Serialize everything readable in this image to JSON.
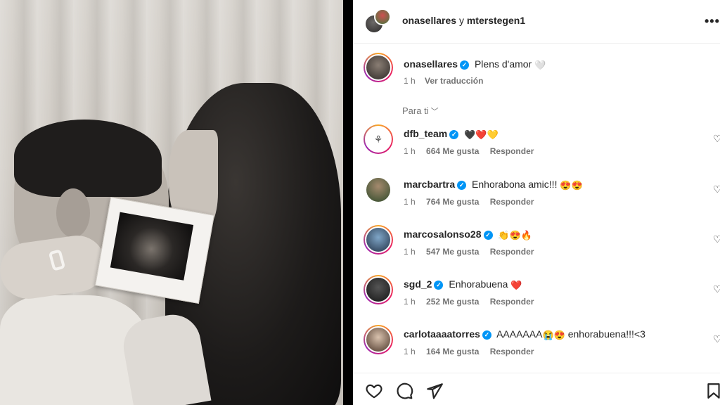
{
  "header": {
    "user1": "onasellares",
    "connector": "y",
    "user2": "mterstegen1",
    "more": "•••"
  },
  "caption": {
    "username": "onasellares",
    "text": "Plens d'amor",
    "emoji": "🤍",
    "time": "1 h",
    "translate": "Ver traducción"
  },
  "filter": {
    "label": "Para ti"
  },
  "comments": [
    {
      "username": "dfb_team",
      "text": "",
      "emojis": "🖤❤️💛",
      "time": "1 h",
      "likes": "664 Me gusta",
      "reply": "Responder"
    },
    {
      "username": "marcbartra",
      "text": "Enhorabona amic!!!",
      "emojis": "😍😍",
      "time": "1 h",
      "likes": "764 Me gusta",
      "reply": "Responder"
    },
    {
      "username": "marcosalonso28",
      "text": "",
      "emojis": "👏😍🔥",
      "time": "1 h",
      "likes": "547 Me gusta",
      "reply": "Responder"
    },
    {
      "username": "sgd_2",
      "text": "Enhorabuena",
      "emojis": "❤️",
      "time": "1 h",
      "likes": "252 Me gusta",
      "reply": "Responder"
    },
    {
      "username": "carlotaaaatorres",
      "text": "AAAAAAA",
      "emojis": "😭😍",
      "text2": "enhorabuena!!!<3",
      "time": "1 h",
      "likes": "164 Me gusta",
      "reply": "Responder"
    }
  ],
  "colors": {
    "verified": "#0095f6",
    "meta": "#737373",
    "text": "#262626"
  }
}
